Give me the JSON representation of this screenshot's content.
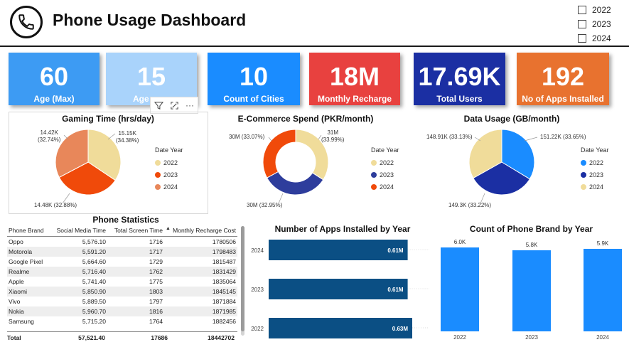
{
  "header": {
    "title": "Phone Usage Dashboard"
  },
  "year_slicer": {
    "options": [
      "2022",
      "2023",
      "2024"
    ]
  },
  "kpis": [
    {
      "value": "60",
      "label": "Age (Max)",
      "color": "#3d9bf3"
    },
    {
      "value": "15",
      "label": "Age",
      "color": "#a9d3fb"
    },
    {
      "value": "10",
      "label": "Count of Cities",
      "color": "#1a8cff"
    },
    {
      "value": "18M",
      "label": "Monthly Recharge",
      "color": "#e8413f"
    },
    {
      "value": "17.69K",
      "label": "Total Users",
      "color": "#1b2fa3"
    },
    {
      "value": "192",
      "label": "No of Apps Installed",
      "color": "#e8722f"
    }
  ],
  "toolbar": {
    "filter_icon": "filter-icon",
    "focus_icon": "focus-mode-icon",
    "more_label": "···"
  },
  "chart_data": [
    {
      "type": "pie",
      "title": "Gaming Time (hrs/day)",
      "legend_title": "Date Year",
      "categories": [
        "2022",
        "2023",
        "2024"
      ],
      "values": [
        15150,
        14480,
        14420
      ],
      "labels": [
        [
          "15.15K",
          "(34.38%)"
        ],
        [
          "14.48K (32.88%)"
        ],
        [
          "14.42K",
          "(32.74%)"
        ]
      ],
      "colors": [
        "#f0dc9a",
        "#f04a0a",
        "#e8875a"
      ],
      "legend": "right"
    },
    {
      "type": "pie",
      "donut": true,
      "title": "E-Commerce Spend (PKR/month)",
      "legend_title": "Date Year",
      "categories": [
        "2022",
        "2023",
        "2024"
      ],
      "values": [
        31,
        30,
        30
      ],
      "labels": [
        [
          "31M",
          "(33.99%)"
        ],
        [
          "30M (32.95%)"
        ],
        [
          "30M (33.07%)"
        ]
      ],
      "colors": [
        "#f0dc9a",
        "#2e3d9c",
        "#f04a0a"
      ],
      "legend": "right"
    },
    {
      "type": "pie",
      "title": "Data Usage (GB/month)",
      "legend_title": "Date Year",
      "categories": [
        "2022",
        "2023",
        "2024"
      ],
      "values": [
        148910,
        149300,
        151220
      ],
      "labels": [
        [
          "148.91K (33.13%)"
        ],
        [
          "149.3K (33.22%)"
        ],
        [
          "151.22K (33.65%)"
        ]
      ],
      "legend_colors": [
        "#1a8cff",
        "#1b2fa3",
        "#f0dc9a"
      ],
      "legend": "right"
    },
    {
      "type": "bar",
      "orientation": "horizontal",
      "title": "Number of Apps Installed by Year",
      "categories": [
        "2024",
        "2023",
        "2022"
      ],
      "values": [
        0.61,
        0.61,
        0.63
      ],
      "value_labels": [
        "0.61M",
        "0.61M",
        "0.63M"
      ],
      "color": "#0b4f84"
    },
    {
      "type": "bar",
      "title": "Count of Phone Brand by Year",
      "categories": [
        "2022",
        "2023",
        "2024"
      ],
      "values": [
        6.0,
        5.8,
        5.9
      ],
      "value_labels": [
        "6.0K",
        "5.8K",
        "5.9K"
      ],
      "color": "#1a8cff"
    }
  ],
  "stats_table": {
    "title": "Phone Statistics",
    "columns": [
      "Phone Brand",
      "Social Media Time",
      "Total Screen Time",
      "Monthly Recharge Cost"
    ],
    "rows": [
      [
        "Oppo",
        "5,576.10",
        "1716",
        "1780506"
      ],
      [
        "Motorola",
        "5,591.20",
        "1717",
        "1798483"
      ],
      [
        "Google Pixel",
        "5,664.60",
        "1729",
        "1815487"
      ],
      [
        "Realme",
        "5,716.40",
        "1762",
        "1831429"
      ],
      [
        "Apple",
        "5,741.40",
        "1775",
        "1835064"
      ],
      [
        "Xiaomi",
        "5,850.90",
        "1803",
        "1845145"
      ],
      [
        "Vivo",
        "5,889.50",
        "1797",
        "1871884"
      ],
      [
        "Nokia",
        "5,960.70",
        "1816",
        "1871985"
      ],
      [
        "Samsung",
        "5,715.20",
        "1764",
        "1882456"
      ]
    ],
    "total": [
      "Total",
      "57,521.40",
      "17686",
      "18442702"
    ]
  }
}
